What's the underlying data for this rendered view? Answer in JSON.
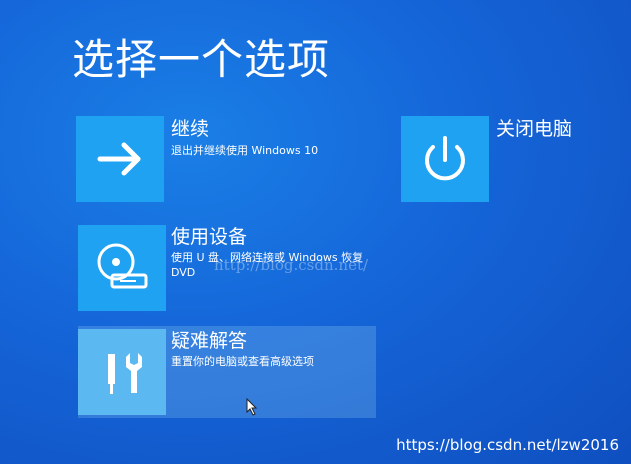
{
  "screen": {
    "title": "选择一个选项"
  },
  "options": {
    "continue": {
      "title": "继续",
      "description": "退出并继续使用 Windows 10",
      "icon": "arrow-right-icon"
    },
    "use_device": {
      "title": "使用设备",
      "description": "使用 U 盘、网络连接或 Windows 恢复 DVD",
      "icon": "disc-drive-icon"
    },
    "troubleshoot": {
      "title": "疑难解答",
      "description": "重置你的电脑或查看高级选项",
      "icon": "tools-icon"
    },
    "shutdown": {
      "title": "关闭电脑",
      "icon": "power-icon"
    }
  },
  "watermarks": {
    "middle": "http://blog.csdn.net/",
    "corner": "https://blog.csdn.net/lzw2016"
  },
  "colors": {
    "background": "#1565d8",
    "tile": "#1fa2f2",
    "tile_selected": "#5bb8f0",
    "text": "#ffffff"
  }
}
